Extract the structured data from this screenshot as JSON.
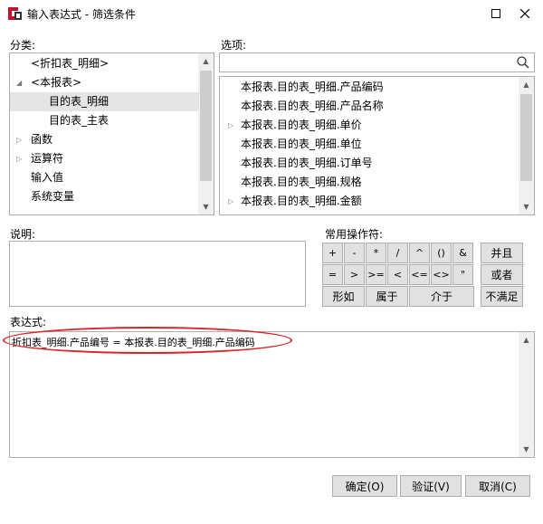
{
  "window": {
    "title": "输入表达式 - 筛选条件",
    "maximize_icon": "maximize-icon",
    "close_icon": "close-icon"
  },
  "category": {
    "label": "分类:",
    "items": [
      {
        "label": "<折扣表_明细>",
        "indent": 1,
        "arrow": ""
      },
      {
        "label": "<本报表>",
        "indent": 1,
        "arrow": "expanded"
      },
      {
        "label": "目的表_明细",
        "indent": 2,
        "arrow": "",
        "selected": true
      },
      {
        "label": "目的表_主表",
        "indent": 2,
        "arrow": ""
      },
      {
        "label": "函数",
        "indent": 1,
        "arrow": "collapsed"
      },
      {
        "label": "运算符",
        "indent": 1,
        "arrow": "collapsed"
      },
      {
        "label": "输入值",
        "indent": 1,
        "arrow": ""
      },
      {
        "label": "系统变量",
        "indent": 1,
        "arrow": ""
      }
    ]
  },
  "options": {
    "label": "选项:",
    "search_value": "",
    "search_icon": "search-icon",
    "items": [
      {
        "label": "本报表.目的表_明细.产品编码",
        "arrow": ""
      },
      {
        "label": "本报表.目的表_明细.产品名称",
        "arrow": ""
      },
      {
        "label": "本报表.目的表_明细.单价",
        "arrow": "collapsed"
      },
      {
        "label": "本报表.目的表_明细.单位",
        "arrow": ""
      },
      {
        "label": "本报表.目的表_明细.订单号",
        "arrow": ""
      },
      {
        "label": "本报表.目的表_明细.规格",
        "arrow": ""
      },
      {
        "label": "本报表.目的表_明细.金额",
        "arrow": "collapsed"
      }
    ]
  },
  "description": {
    "label": "说明:",
    "value": ""
  },
  "operators": {
    "label": "常用操作符:",
    "row1": [
      "+",
      "-",
      "*",
      "/",
      "^",
      "()",
      "&"
    ],
    "row2": [
      "=",
      ">",
      ">=",
      "<",
      "<=",
      "<>",
      "\""
    ],
    "like": "形如",
    "in": "属于",
    "between": "介于",
    "and": "并且",
    "or": "或者",
    "not": "不满足"
  },
  "expression": {
    "label": "表达式:",
    "value": "折扣表_明细.产品编号 = 本报表.目的表_明细.产品编码"
  },
  "buttons": {
    "ok": "确定(O)",
    "verify": "验证(V)",
    "cancel": "取消(C)"
  }
}
